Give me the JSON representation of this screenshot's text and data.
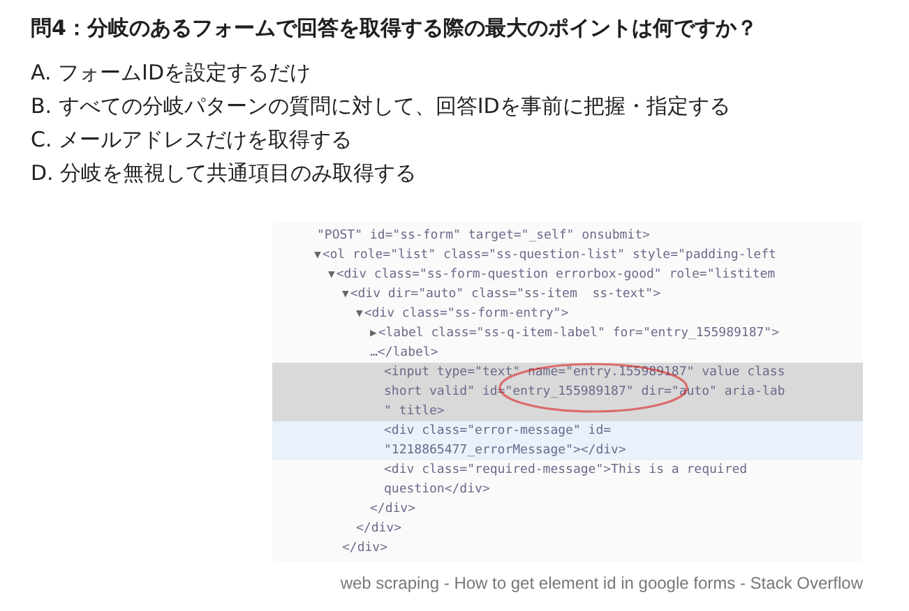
{
  "question": "問4：分岐のあるフォームで回答を取得する際の最大のポイントは何ですか？",
  "options": [
    {
      "letter": "A.",
      "text": "フォームIDを設定するだけ"
    },
    {
      "letter": "B.",
      "text": "すべての分岐パターンの質問に対して、回答IDを事前に把握・指定する"
    },
    {
      "letter": "C.",
      "text": "メールアドレスだけを取得する"
    },
    {
      "letter": "D.",
      "text": "分岐を無視して共通項目のみ取得する"
    }
  ],
  "screenshot": {
    "tree": [
      {
        "lines": [
          "\"POST\" id=\"ss-form\" target=\"_self\" onsubmit>"
        ]
      },
      {
        "toggle": "▼",
        "lines": [
          "<ol role=\"list\" class=\"ss-question-list\" style=\"padding-left"
        ],
        "children": [
          {
            "toggle": "▼",
            "lines": [
              "<div class=\"ss-form-question errorbox-good\" role=\"listitem"
            ],
            "close": "</div>",
            "children": [
              {
                "toggle": "▼",
                "lines": [
                  "<div dir=\"auto\" class=\"ss-item  ss-text\">"
                ],
                "close": "</div>",
                "children": [
                  {
                    "toggle": "▼",
                    "lines": [
                      "<div class=\"ss-form-entry\">"
                    ],
                    "close": "</div>",
                    "children": [
                      {
                        "toggle": "▶",
                        "lines": [
                          "<label class=\"ss-q-item-label\" for=\"entry_155989187\">",
                          "…</label>"
                        ],
                        "selected": false,
                        "hovered": false
                      },
                      {
                        "lines": [
                          "<input type=\"text\" name=\"entry.155989187\" value class",
                          "short valid\" id=\"entry_155989187\" dir=\"auto\" aria-lab",
                          "\" title>"
                        ],
                        "selected": true,
                        "hovered": false
                      },
                      {
                        "lines": [
                          "<div class=\"error-message\" id=",
                          "\"1218865477_errorMessage\"></div>"
                        ],
                        "selected": false,
                        "hovered": true
                      },
                      {
                        "lines": [
                          "<div class=\"required-message\">This is a required",
                          "question</div>"
                        ],
                        "selected": false,
                        "hovered": false
                      }
                    ]
                  }
                ]
              }
            ]
          }
        ]
      }
    ]
  },
  "caption": "web scraping - How to get element id in google forms - Stack Overflow"
}
